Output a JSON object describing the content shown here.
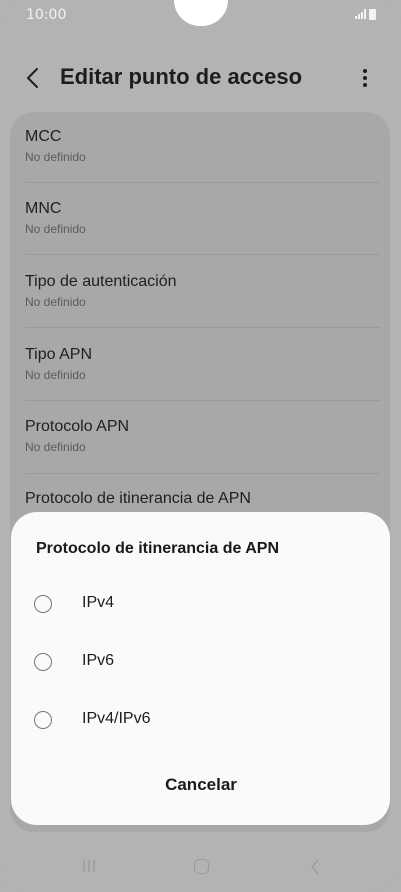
{
  "status_bar": {
    "time": "10:00"
  },
  "header": {
    "title": "Editar punto de acceso"
  },
  "list": {
    "items": [
      {
        "title": "MCC",
        "subtitle": "No definido"
      },
      {
        "title": "MNC",
        "subtitle": "No definido"
      },
      {
        "title": "Tipo de autenticación",
        "subtitle": "No definido"
      },
      {
        "title": "Tipo APN",
        "subtitle": "No definido"
      },
      {
        "title": "Protocolo APN",
        "subtitle": "No definido"
      },
      {
        "title": "Protocolo de itinerancia de APN"
      }
    ]
  },
  "sheet": {
    "title": "Protocolo de itinerancia de APN",
    "options": [
      {
        "label": "IPv4"
      },
      {
        "label": "IPv6"
      },
      {
        "label": "IPv4/IPv6"
      }
    ],
    "cancel_label": "Cancelar"
  },
  "colors": {
    "background_dim": "#b3b3b3",
    "sheet": "#fafafa",
    "text": "#1d1d1d"
  }
}
